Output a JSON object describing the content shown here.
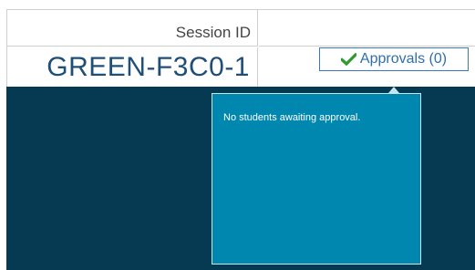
{
  "session": {
    "label": "Session ID",
    "id": "GREEN-F3C0-1"
  },
  "approvals": {
    "icon": "check-icon",
    "label": "Approvals (0)",
    "popover_message": "No students awaiting approval."
  },
  "colors": {
    "panel_dark": "#063a52",
    "popover_bg": "#0087b0",
    "accent_blue": "#2f6faf",
    "check_green": "#2e9a2e",
    "session_id_text": "#1f4e79"
  }
}
